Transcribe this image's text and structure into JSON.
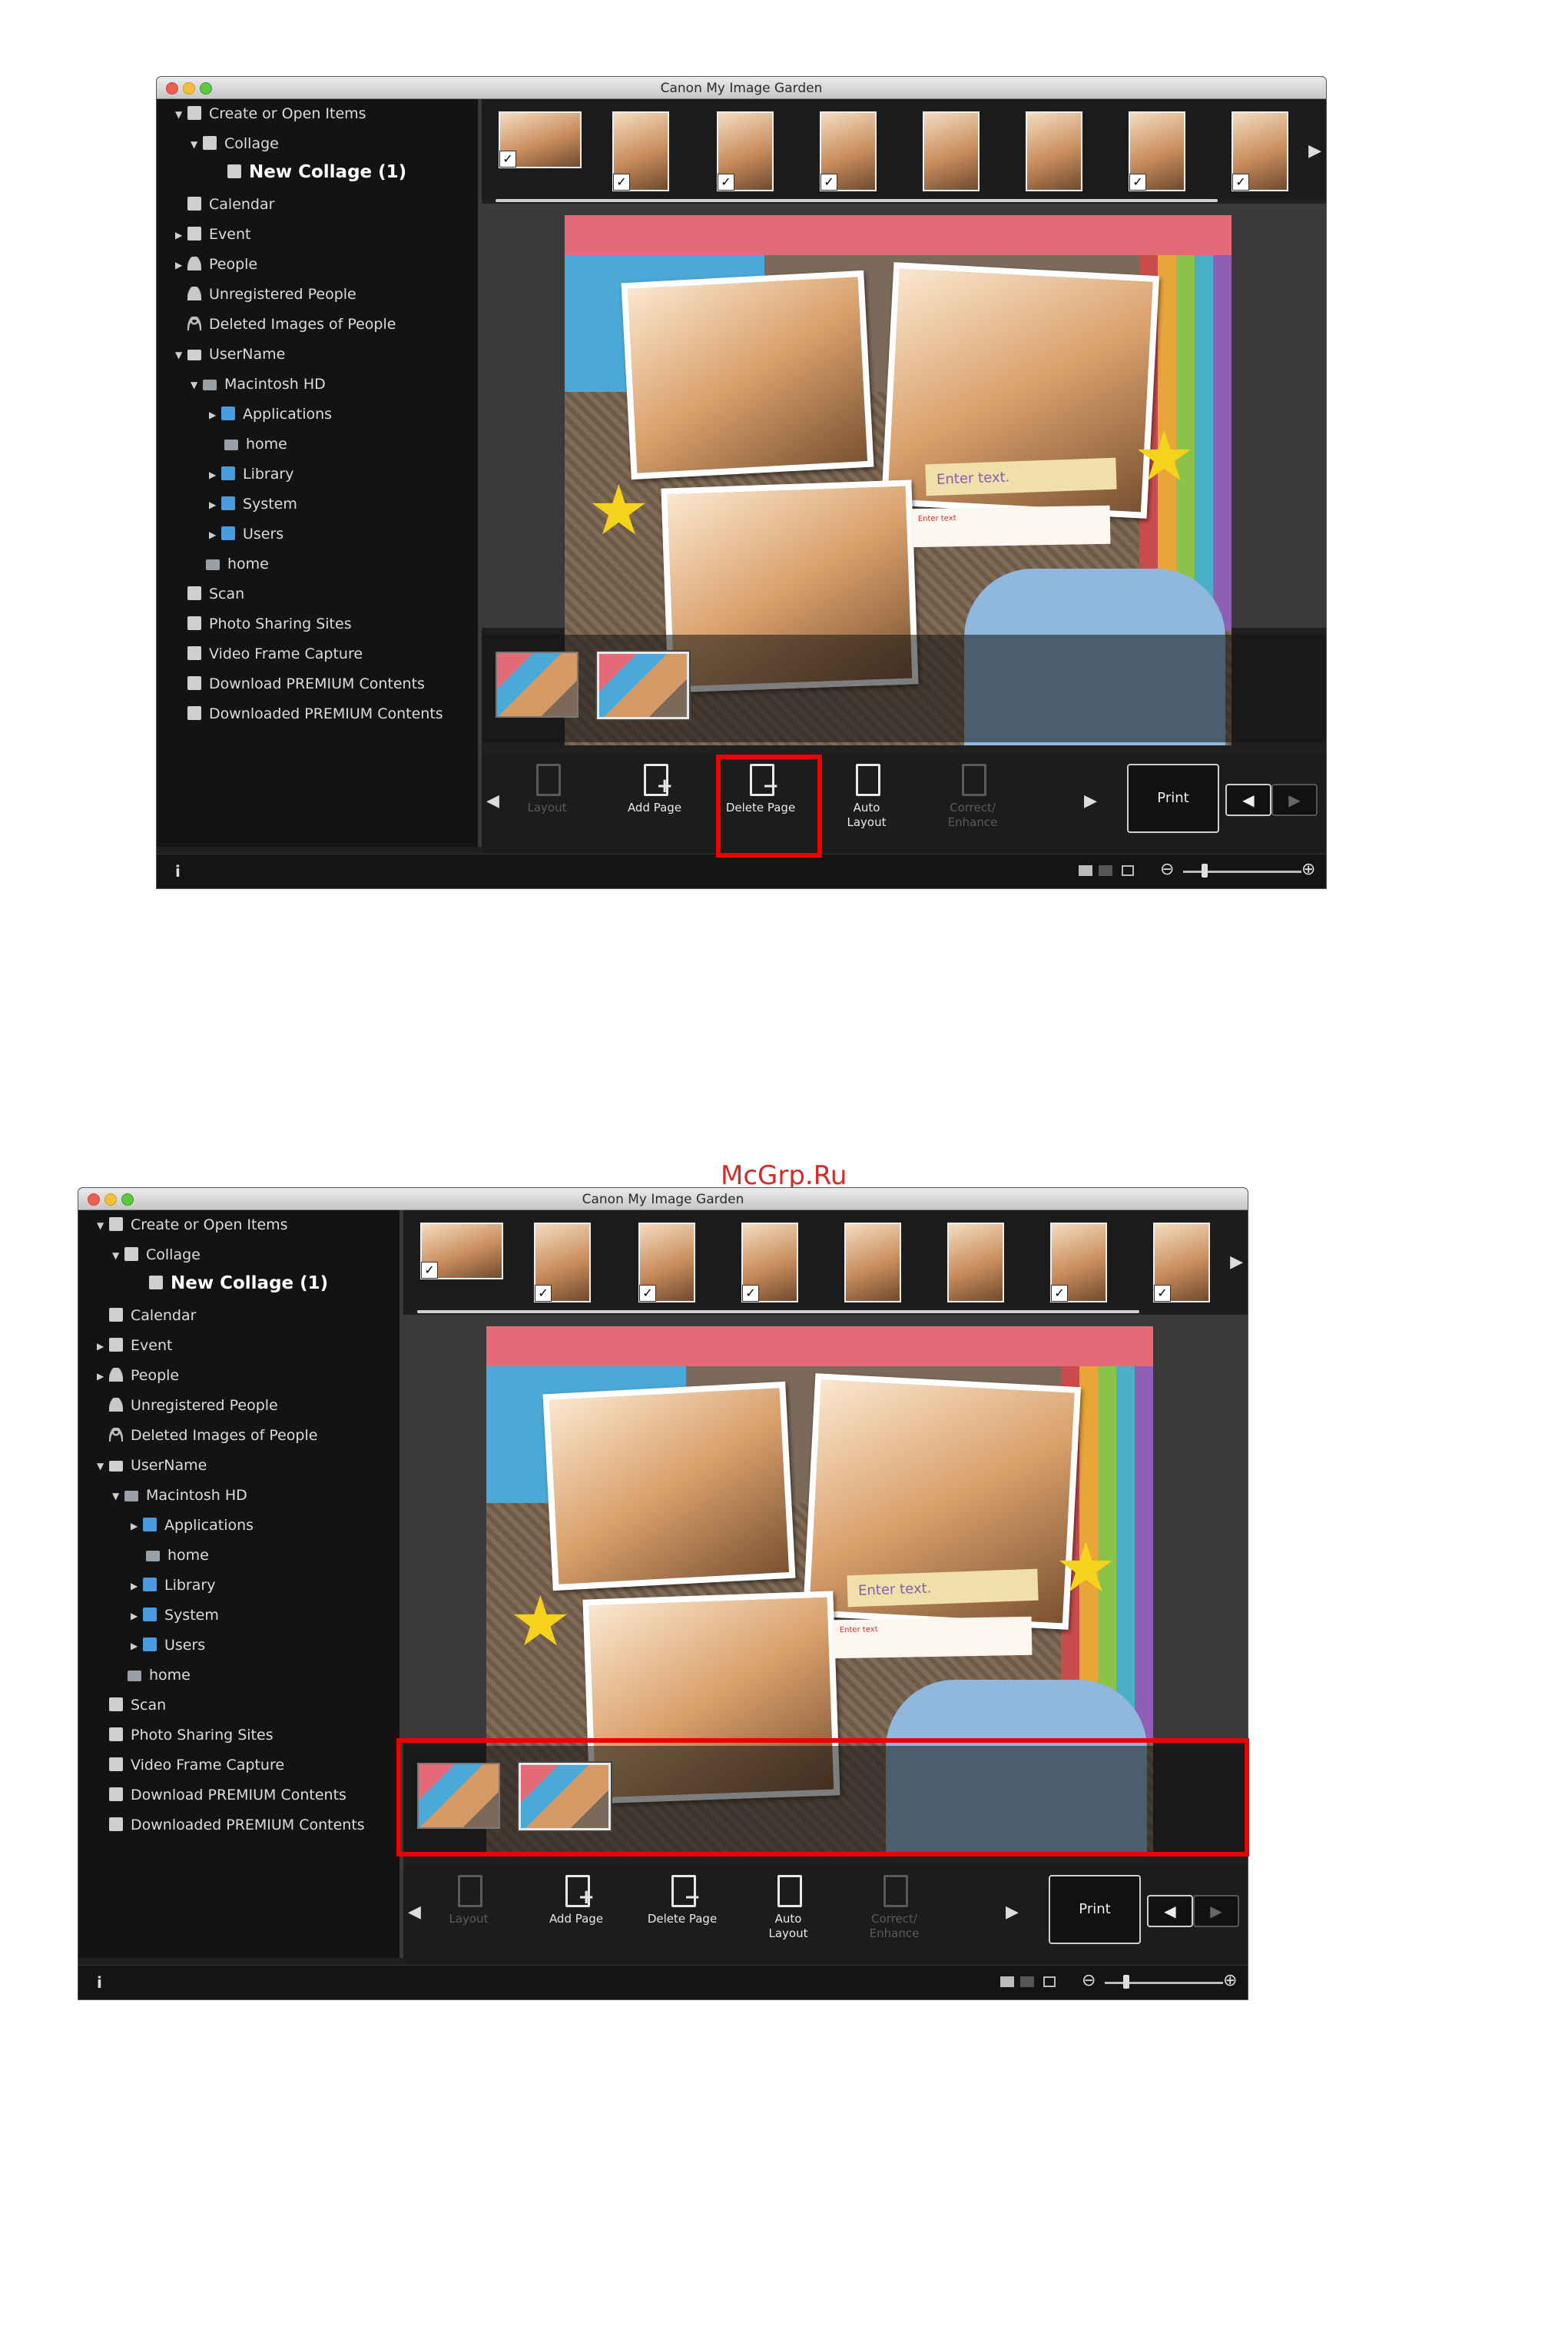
{
  "app": {
    "title": "Canon My Image Garden"
  },
  "watermark": "McGrp.Ru",
  "sidebar": {
    "items": [
      {
        "label": "Create or Open Items"
      },
      {
        "label": "Collage"
      },
      {
        "label": "New Collage (1)"
      },
      {
        "label": "Calendar"
      },
      {
        "label": "Event"
      },
      {
        "label": "People"
      },
      {
        "label": "Unregistered People"
      },
      {
        "label": "Deleted Images of People"
      },
      {
        "label": "UserName"
      },
      {
        "label": "Macintosh HD"
      },
      {
        "label": "Applications"
      },
      {
        "label": "home"
      },
      {
        "label": "Library"
      },
      {
        "label": "System"
      },
      {
        "label": "Users"
      },
      {
        "label": "home"
      },
      {
        "label": "Scan"
      },
      {
        "label": "Photo Sharing Sites"
      },
      {
        "label": "Video Frame Capture"
      },
      {
        "label": "Download PREMIUM Contents"
      },
      {
        "label": "Downloaded PREMIUM Contents"
      }
    ]
  },
  "canvas": {
    "note_main": "Enter text.",
    "note_small": "Enter text"
  },
  "toolbar": {
    "layout": "Layout",
    "add_page": "Add Page",
    "delete_page": "Delete Page",
    "auto_layout_1": "Auto",
    "auto_layout_2": "Layout",
    "correct_1": "Correct/",
    "correct_2": "Enhance",
    "print": "Print"
  },
  "status": {
    "info": "i"
  },
  "colors": {
    "highlight": "#e00000",
    "window_bg": "#1f1f1f",
    "folder_icon": "#4b9be0"
  }
}
